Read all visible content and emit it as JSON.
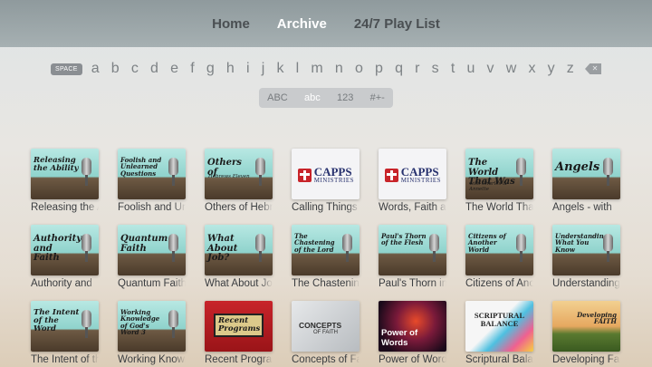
{
  "nav": {
    "tabs": [
      {
        "label": "Home",
        "active": false
      },
      {
        "label": "Archive",
        "active": true
      },
      {
        "label": "24/7 Play List",
        "active": false
      }
    ]
  },
  "keyboard": {
    "space_label": "SPACE",
    "letters": [
      "a",
      "b",
      "c",
      "d",
      "e",
      "f",
      "g",
      "h",
      "i",
      "j",
      "k",
      "l",
      "m",
      "n",
      "o",
      "p",
      "q",
      "r",
      "s",
      "t",
      "u",
      "v",
      "w",
      "x",
      "y",
      "z"
    ],
    "delete_icon": "backspace-icon",
    "modes": [
      {
        "label": "ABC",
        "active": false
      },
      {
        "label": "abc",
        "active": true
      },
      {
        "label": "123",
        "active": false
      },
      {
        "label": "#+-",
        "active": false
      }
    ]
  },
  "programs": [
    {
      "thumb_text": "Releasing the Ability",
      "label": "Releasing the Ability"
    },
    {
      "thumb_text": "Foolish and Unlearned Questions",
      "label": "Foolish and Unlearned Questions"
    },
    {
      "thumb_text": "Others of",
      "thumb_sub": "Hebrews Eleven",
      "label": "Others of Hebrews Eleven"
    },
    {
      "logo_word": "CAPPS",
      "logo_sub": "MINISTRIES",
      "label": "Calling Things"
    },
    {
      "logo_word": "CAPPS",
      "logo_sub": "MINISTRIES",
      "label": "Words, Faith a"
    },
    {
      "thumb_text": "The World That Was",
      "thumb_sub": "with Charles & Annette",
      "label": "The World That Was"
    },
    {
      "thumb_text": "Angels",
      "label": "Angels - with"
    },
    {
      "thumb_text": "Authority and Faith",
      "label": "Authority and"
    },
    {
      "thumb_text": "Quantum Faith",
      "label": "Quantum Faith"
    },
    {
      "thumb_text": "What About Job?",
      "label": "What About Job"
    },
    {
      "thumb_text": "The Chastening of the Lord",
      "label": "The Chastening"
    },
    {
      "thumb_text": "Paul's Thorn of the Flesh",
      "label": "Paul's Thorn in"
    },
    {
      "thumb_text": "Citizens of Another World",
      "label": "Citizens of Another World"
    },
    {
      "thumb_text": "Understanding What You Know",
      "label": "Understanding"
    },
    {
      "thumb_text": "The Intent of the Word",
      "label": "The Intent of the Word"
    },
    {
      "thumb_text": "Working Knowledge of God's Word 3",
      "label": "Working Knowledge"
    },
    {
      "thumb_text": "Recent Programs",
      "label": "Recent Programs"
    },
    {
      "thumb_text": "CONCEPTS",
      "thumb_sub": "OF FAITH",
      "label": "Concepts of Faith"
    },
    {
      "thumb_text": "Power of Words",
      "label": "Power of Words"
    },
    {
      "thumb_text": "SCRIPTURAL BALANCE",
      "label": "Scriptural Balance"
    },
    {
      "thumb_text": "Developing FAITH",
      "label": "Developing Faith"
    }
  ]
}
